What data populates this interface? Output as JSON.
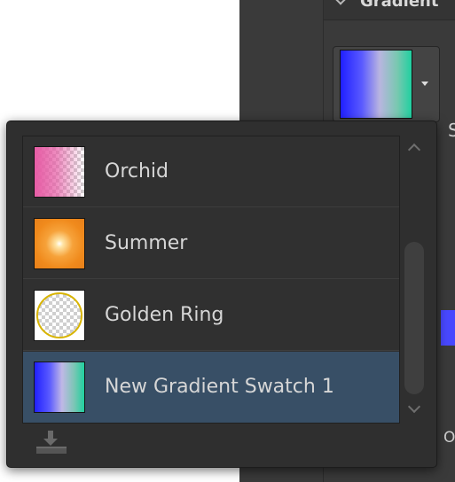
{
  "background_panel": {
    "header_title": "Gradient",
    "fragment_s": "S",
    "fragment_o": "O"
  },
  "gradient_dropdown": {
    "items": [
      {
        "label": "Orchid",
        "swatch": "orchid-transparent-gradient",
        "selected": false
      },
      {
        "label": "Summer",
        "swatch": "orange-radial-gradient",
        "selected": false
      },
      {
        "label": "Golden Ring",
        "swatch": "golden-ring-gradient",
        "selected": false
      },
      {
        "label": "New Gradient Swatch 1",
        "swatch": "blue-teal-linear-gradient",
        "selected": true
      }
    ],
    "footer_icon": "import-download-icon"
  },
  "colors": {
    "popup_bg": "#2f2f2f",
    "selected_row": "#384f66",
    "text": "#d6d6d6"
  }
}
